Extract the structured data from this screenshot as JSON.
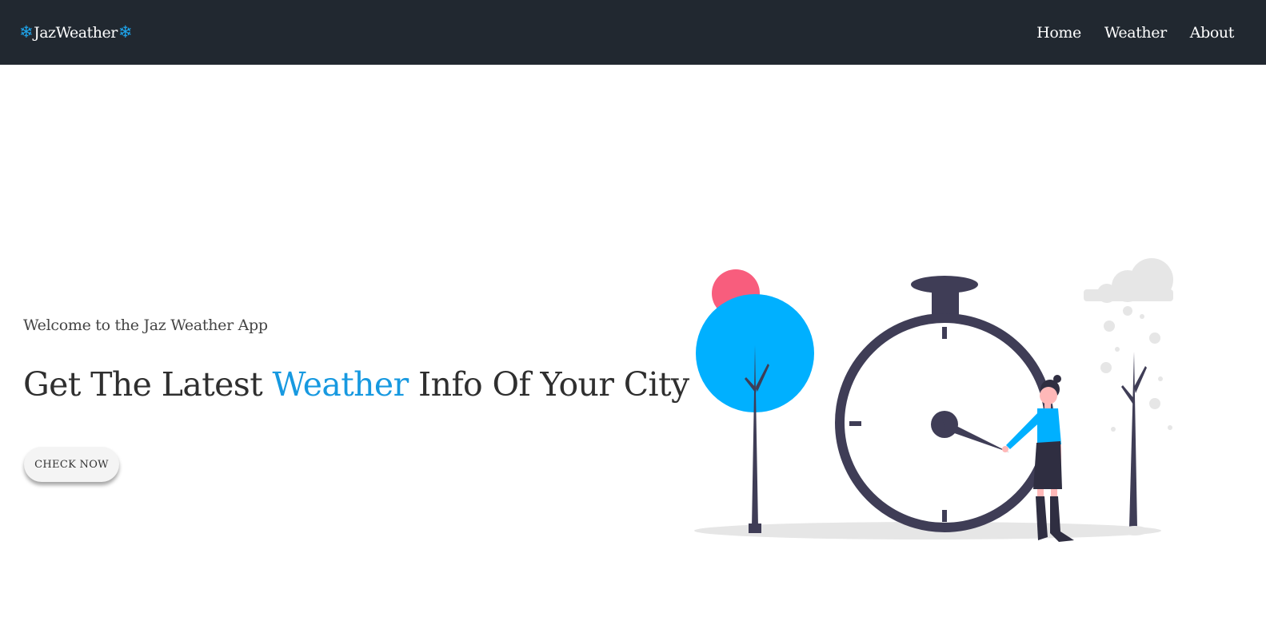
{
  "navbar": {
    "brand": {
      "text": "JazWeather",
      "left_icon": "snowflake-icon",
      "right_icon": "snowflake-icon",
      "icon_color": "#1ea5ec"
    },
    "links": [
      {
        "label": "Home"
      },
      {
        "label": "Weather"
      },
      {
        "label": "About"
      }
    ],
    "background": "#212830"
  },
  "hero": {
    "welcome": "Welcome to the Jaz Weather App",
    "headline_before": "Get The Latest ",
    "headline_accent": "Weather",
    "headline_after": " Info Of Your City",
    "accent_color": "#1799e0",
    "cta_label": "CHECK NOW"
  },
  "illustration": {
    "subject": "woman-pointing-at-clock-illustration",
    "colors": {
      "blue": "#00b0ff",
      "pink": "#f85d7d",
      "dark": "#3f3d56",
      "gray": "#e6e6e6"
    }
  }
}
